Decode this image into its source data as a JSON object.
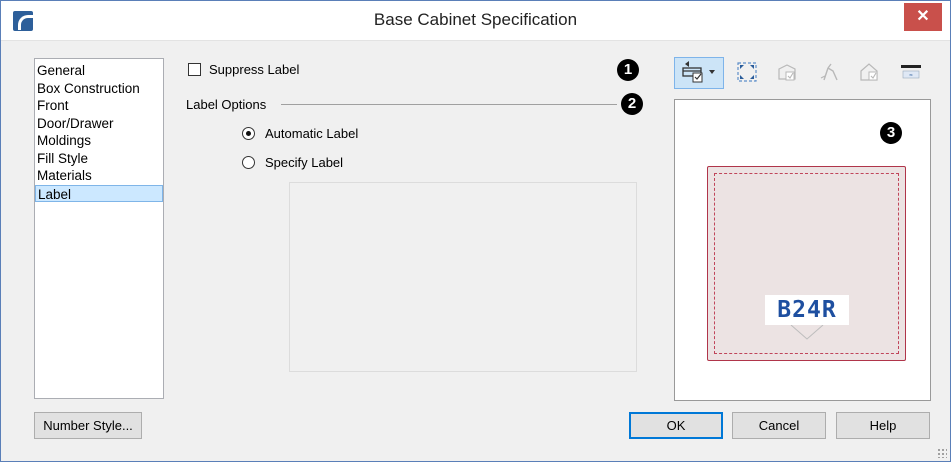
{
  "window": {
    "title": "Base Cabinet Specification",
    "close_glyph": "✕"
  },
  "nav": {
    "items": [
      {
        "label": "General"
      },
      {
        "label": "Box Construction"
      },
      {
        "label": "Front"
      },
      {
        "label": "Door/Drawer"
      },
      {
        "label": "Moldings"
      },
      {
        "label": "Fill Style"
      },
      {
        "label": "Materials"
      },
      {
        "label": "Label",
        "selected": true
      }
    ]
  },
  "label_panel": {
    "suppress_label": {
      "label": "Suppress Label",
      "checked": false
    },
    "group_title": "Label Options",
    "automatic_label": {
      "label": "Automatic Label",
      "selected": true
    },
    "specify_label": {
      "label": "Specify Label",
      "selected": false
    },
    "specify_text": ""
  },
  "markers": [
    "1",
    "2",
    "3"
  ],
  "toolbar": {
    "icons": [
      "view-selector-icon",
      "fill-window-icon",
      "plan-view-icon",
      "camera-view-icon",
      "elevation-view-icon",
      "toggle-label-icon"
    ]
  },
  "preview": {
    "cabinet_label": "B24R"
  },
  "buttons": {
    "number_style": "Number Style...",
    "ok": "OK",
    "cancel": "Cancel",
    "help": "Help"
  }
}
